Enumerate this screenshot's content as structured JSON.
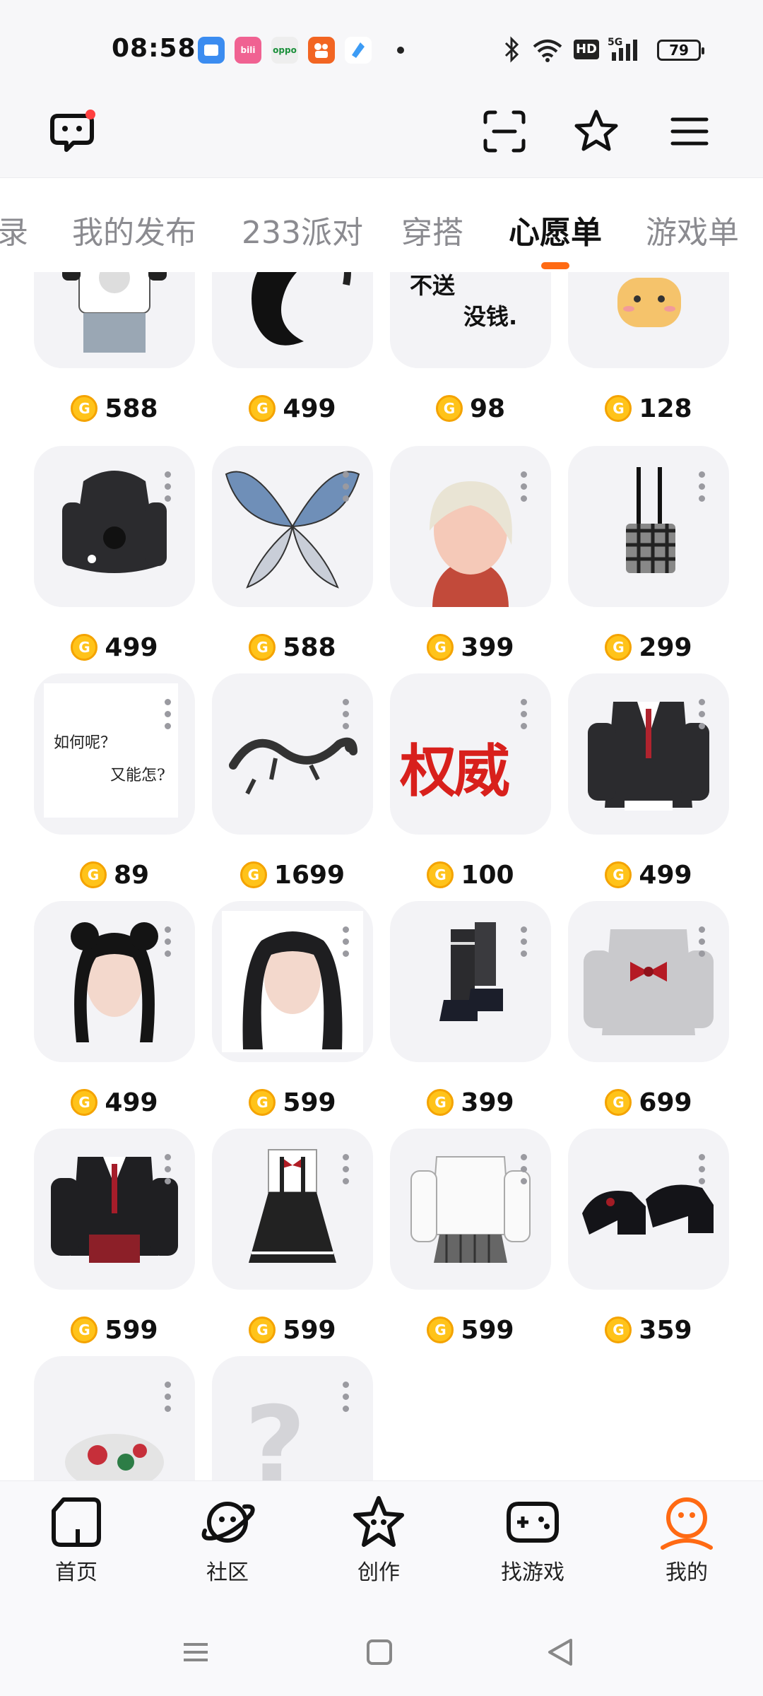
{
  "status_bar": {
    "time": "08:58",
    "apps": [
      {
        "icon": "files-app-icon",
        "color": "#3b8cf0",
        "label": ""
      },
      {
        "icon": "bilibili-app-icon",
        "color": "#f06292",
        "label": "bili"
      },
      {
        "icon": "oppo-app-icon",
        "color": "#eeeeee",
        "label": "oppo"
      },
      {
        "icon": "kuaishou-app-icon",
        "color": "#f26522",
        "label": ""
      },
      {
        "icon": "browser-app-icon",
        "color": "#3d9cf5",
        "label": ""
      }
    ],
    "battery": "79",
    "network": "5G",
    "hd_badge": "HD"
  },
  "header": {
    "icons": [
      "chat-bubble-icon",
      "scan-icon",
      "star-icon",
      "menu-icon"
    ]
  },
  "tabs": [
    {
      "label": "录",
      "active": false
    },
    {
      "label": "我的发布",
      "active": false
    },
    {
      "label": "233派对",
      "active": false
    },
    {
      "label": "穿搭",
      "active": false
    },
    {
      "label": "心愿单",
      "active": true
    },
    {
      "label": "游戏单",
      "active": false
    }
  ],
  "wishlist": {
    "items": [
      {
        "price": "588",
        "art": "shirt-skirt"
      },
      {
        "price": "499",
        "art": "tail"
      },
      {
        "price": "98",
        "art": "text-sticker"
      },
      {
        "price": "128",
        "art": "cat-bread"
      },
      {
        "price": "499",
        "art": "hoodie"
      },
      {
        "price": "588",
        "art": "wings"
      },
      {
        "price": "399",
        "art": "blonde-hair"
      },
      {
        "price": "299",
        "art": "handbag"
      },
      {
        "price": "89",
        "art": "text-card"
      },
      {
        "price": "1699",
        "art": "dragon"
      },
      {
        "price": "100",
        "art": "red-calligraphy"
      },
      {
        "price": "499",
        "art": "black-cardigan"
      },
      {
        "price": "499",
        "art": "black-buns-hair"
      },
      {
        "price": "599",
        "art": "black-long-hair"
      },
      {
        "price": "399",
        "art": "boots"
      },
      {
        "price": "699",
        "art": "grey-bow-cardigan"
      },
      {
        "price": "599",
        "art": "black-blazer-uniform"
      },
      {
        "price": "599",
        "art": "suspender-dress"
      },
      {
        "price": "599",
        "art": "white-sweater-skirt"
      },
      {
        "price": "359",
        "art": "mary-jane-shoes"
      },
      {
        "price": "",
        "art": "floral-beret"
      },
      {
        "price": "",
        "art": "mystery"
      }
    ],
    "text_sticker": {
      "line1": "不送",
      "line2": "没钱."
    },
    "text_card": {
      "line1": "如何呢？",
      "line2": "又能怎?"
    },
    "calligraphy": "权威"
  },
  "bottom_nav": [
    {
      "label": "首页",
      "icon": "home-icon",
      "active": false
    },
    {
      "label": "社区",
      "icon": "planet-icon",
      "active": false
    },
    {
      "label": "创作",
      "icon": "create-star-icon",
      "active": false
    },
    {
      "label": "找游戏",
      "icon": "gamepad-icon",
      "active": false
    },
    {
      "label": "我的",
      "icon": "profile-icon",
      "active": true
    }
  ],
  "colors": {
    "accent": "#ff6a13",
    "coin": "#ffc31a",
    "card_bg": "#f3f3f6",
    "tab_inactive": "#8b8b90"
  }
}
